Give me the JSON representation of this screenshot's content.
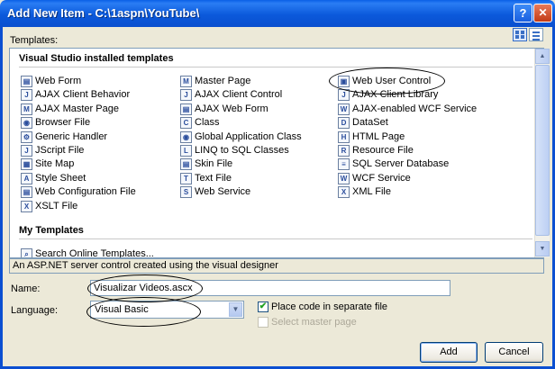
{
  "window": {
    "title": "Add New Item - C:\\1aspn\\YouTube\\",
    "help_glyph": "?",
    "close_glyph": "✕"
  },
  "templates_label": "Templates:",
  "sections": [
    {
      "name": "installed",
      "title": "Visual Studio installed templates"
    },
    {
      "name": "my",
      "title": "My Templates"
    }
  ],
  "items": {
    "col1": [
      {
        "label": "Web Form",
        "icon": "web-form-icon"
      },
      {
        "label": "AJAX Client Behavior",
        "icon": "ajax-client-behavior-icon"
      },
      {
        "label": "AJAX Master Page",
        "icon": "ajax-master-page-icon"
      },
      {
        "label": "Browser File",
        "icon": "browser-file-icon"
      },
      {
        "label": "Generic Handler",
        "icon": "generic-handler-icon"
      },
      {
        "label": "JScript File",
        "icon": "jscript-file-icon"
      },
      {
        "label": "Site Map",
        "icon": "site-map-icon"
      },
      {
        "label": "Style Sheet",
        "icon": "style-sheet-icon"
      },
      {
        "label": "Web Configuration File",
        "icon": "web-config-icon"
      },
      {
        "label": "XSLT File",
        "icon": "xslt-file-icon"
      }
    ],
    "col2": [
      {
        "label": "Master Page",
        "icon": "master-page-icon"
      },
      {
        "label": "AJAX Client Control",
        "icon": "ajax-client-control-icon"
      },
      {
        "label": "AJAX Web Form",
        "icon": "ajax-web-form-icon"
      },
      {
        "label": "Class",
        "icon": "class-icon"
      },
      {
        "label": "Global Application Class",
        "icon": "global-app-class-icon"
      },
      {
        "label": "LINQ to SQL Classes",
        "icon": "linq-to-sql-icon"
      },
      {
        "label": "Skin File",
        "icon": "skin-file-icon"
      },
      {
        "label": "Text File",
        "icon": "text-file-icon"
      },
      {
        "label": "Web Service",
        "icon": "web-service-icon"
      }
    ],
    "col3": [
      {
        "label": "Web User Control",
        "icon": "web-user-control-icon"
      },
      {
        "label": "AJAX Client Library",
        "icon": "ajax-client-library-icon"
      },
      {
        "label": "AJAX-enabled WCF Service",
        "icon": "ajax-wcf-service-icon"
      },
      {
        "label": "DataSet",
        "icon": "dataset-icon"
      },
      {
        "label": "HTML Page",
        "icon": "html-page-icon"
      },
      {
        "label": "Resource File",
        "icon": "resource-file-icon"
      },
      {
        "label": "SQL Server Database",
        "icon": "sql-database-icon"
      },
      {
        "label": "WCF Service",
        "icon": "wcf-service-icon"
      },
      {
        "label": "XML File",
        "icon": "xml-file-icon"
      }
    ],
    "my": [
      {
        "label": "Search Online Templates...",
        "icon": "search-online-icon"
      }
    ]
  },
  "description": "An ASP.NET server control created using the visual designer",
  "name_label": "Name:",
  "name_value": "Visualizar Videos.ascx",
  "language_label": "Language:",
  "language_value": "Visual Basic",
  "place_code_label": "Place code in separate file",
  "select_master_label": "Select master page",
  "add_label": "Add",
  "cancel_label": "Cancel",
  "colors": {
    "title_blue": "#0b59db",
    "dialog_bg": "#ece9d8",
    "border": "#7f9db9"
  }
}
